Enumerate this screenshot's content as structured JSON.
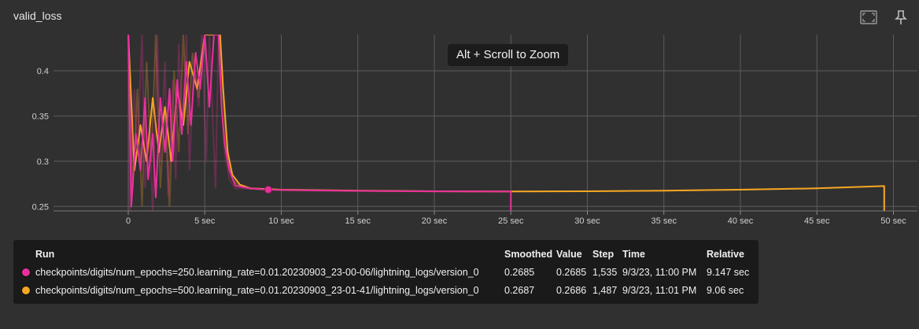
{
  "card": {
    "title": "valid_loss"
  },
  "toolbar": {
    "fit_icon": "fit-to-screen-icon",
    "pin_icon": "pin-icon"
  },
  "tooltip": {
    "text": "Alt + Scroll to Zoom"
  },
  "chart_data": {
    "type": "line",
    "title": "valid_loss",
    "xlabel": "",
    "ylabel": "",
    "xlim": [
      -4.5,
      52
    ],
    "ylim": [
      0.245,
      0.44
    ],
    "x_ticks": [
      "0",
      "5 sec",
      "10 sec",
      "15 sec",
      "20 sec",
      "25 sec",
      "30 sec",
      "35 sec",
      "40 sec",
      "45 sec",
      "50 sec"
    ],
    "x_tick_values": [
      0,
      5,
      10,
      15,
      20,
      25,
      30,
      35,
      40,
      45,
      50
    ],
    "y_ticks": [
      "0.25",
      "0.3",
      "0.35",
      "0.4"
    ],
    "y_tick_values": [
      0.25,
      0.3,
      0.35,
      0.4
    ],
    "grid": true,
    "highlight_point": {
      "x": 9.15,
      "y": 0.2685,
      "series": 0
    },
    "series": [
      {
        "name": "checkpoints/digits/num_epochs=250.learning_rate=0.01.20230903_23-00-06/lightning_logs/version_0",
        "color": "#e8309c",
        "raw": [
          [
            0,
            0.44
          ],
          [
            0.1,
            0.24
          ],
          [
            0.4,
            0.38
          ],
          [
            0.6,
            0.31
          ],
          [
            0.9,
            0.44
          ],
          [
            1.1,
            0.27
          ],
          [
            1.4,
            0.34
          ],
          [
            1.6,
            0.24
          ],
          [
            1.9,
            0.44
          ],
          [
            2.1,
            0.3
          ],
          [
            2.4,
            0.41
          ],
          [
            2.6,
            0.26
          ],
          [
            2.9,
            0.39
          ],
          [
            3.1,
            0.28
          ],
          [
            3.3,
            0.43
          ],
          [
            3.5,
            0.33
          ],
          [
            3.8,
            0.44
          ],
          [
            4,
            0.29
          ],
          [
            4.3,
            0.41
          ],
          [
            4.6,
            0.36
          ],
          [
            4.8,
            0.44
          ],
          [
            5.1,
            0.3
          ],
          [
            5.3,
            0.44
          ],
          [
            5.7,
            0.27
          ],
          [
            5.9,
            0.44
          ],
          [
            6.1,
            0.36
          ],
          [
            6.3,
            0.31
          ],
          [
            6.6,
            0.28
          ],
          [
            7,
            0.27
          ],
          [
            8,
            0.2695
          ],
          [
            9.15,
            0.2685
          ],
          [
            12,
            0.2675
          ],
          [
            15,
            0.267
          ],
          [
            20,
            0.2665
          ],
          [
            25,
            0.2663
          ],
          [
            25,
            0.24
          ]
        ],
        "smoothed": [
          [
            0,
            0.44
          ],
          [
            0.2,
            0.25
          ],
          [
            0.5,
            0.33
          ],
          [
            0.8,
            0.29
          ],
          [
            1.1,
            0.37
          ],
          [
            1.3,
            0.28
          ],
          [
            1.6,
            0.33
          ],
          [
            1.8,
            0.26
          ],
          [
            2.1,
            0.37
          ],
          [
            2.4,
            0.31
          ],
          [
            2.7,
            0.38
          ],
          [
            2.9,
            0.3
          ],
          [
            3.2,
            0.39
          ],
          [
            3.5,
            0.33
          ],
          [
            3.8,
            0.41
          ],
          [
            4.1,
            0.34
          ],
          [
            4.4,
            0.42
          ],
          [
            4.7,
            0.38
          ],
          [
            5,
            0.44
          ],
          [
            5.3,
            0.36
          ],
          [
            5.6,
            0.44
          ],
          [
            5.9,
            0.44
          ],
          [
            6.1,
            0.36
          ],
          [
            6.3,
            0.32
          ],
          [
            6.6,
            0.29
          ],
          [
            7,
            0.273
          ],
          [
            8,
            0.27
          ],
          [
            9.15,
            0.2685
          ],
          [
            12,
            0.2678
          ],
          [
            15,
            0.2672
          ],
          [
            20,
            0.2667
          ],
          [
            25,
            0.2665
          ],
          [
            25,
            0.24
          ]
        ]
      },
      {
        "name": "checkpoints/digits/num_epochs=500.learning_rate=0.01.20230903_23-01-41/lightning_logs/version_0",
        "color": "#f5a623",
        "raw": [
          [
            0,
            0.44
          ],
          [
            0.3,
            0.27
          ],
          [
            0.6,
            0.38
          ],
          [
            0.9,
            0.25
          ],
          [
            1.2,
            0.41
          ],
          [
            1.5,
            0.3
          ],
          [
            1.8,
            0.44
          ],
          [
            2.1,
            0.27
          ],
          [
            2.4,
            0.36
          ],
          [
            2.7,
            0.25
          ],
          [
            3,
            0.4
          ],
          [
            3.3,
            0.31
          ],
          [
            3.6,
            0.44
          ],
          [
            3.9,
            0.33
          ],
          [
            4.2,
            0.42
          ],
          [
            4.6,
            0.37
          ],
          [
            5,
            0.44
          ],
          [
            5.5,
            0.44
          ],
          [
            6,
            0.44
          ],
          [
            6.2,
            0.37
          ],
          [
            6.5,
            0.3
          ],
          [
            6.8,
            0.28
          ],
          [
            7.3,
            0.272
          ],
          [
            8,
            0.2695
          ],
          [
            10,
            0.268
          ],
          [
            15,
            0.2672
          ],
          [
            20,
            0.2667
          ],
          [
            25,
            0.2665
          ],
          [
            30,
            0.2668
          ],
          [
            35,
            0.2675
          ],
          [
            40,
            0.2685
          ],
          [
            45,
            0.27
          ],
          [
            49.4,
            0.2725
          ],
          [
            49.4,
            0.24
          ]
        ],
        "smoothed": [
          [
            0,
            0.44
          ],
          [
            0.4,
            0.29
          ],
          [
            0.8,
            0.34
          ],
          [
            1.2,
            0.3
          ],
          [
            1.6,
            0.37
          ],
          [
            2,
            0.31
          ],
          [
            2.4,
            0.36
          ],
          [
            2.8,
            0.3
          ],
          [
            3.2,
            0.38
          ],
          [
            3.6,
            0.34
          ],
          [
            4,
            0.41
          ],
          [
            4.5,
            0.38
          ],
          [
            5,
            0.44
          ],
          [
            5.5,
            0.44
          ],
          [
            6,
            0.44
          ],
          [
            6.2,
            0.38
          ],
          [
            6.5,
            0.31
          ],
          [
            6.8,
            0.285
          ],
          [
            7.3,
            0.274
          ],
          [
            8,
            0.27
          ],
          [
            10,
            0.2685
          ],
          [
            15,
            0.2675
          ],
          [
            20,
            0.2668
          ],
          [
            25,
            0.2665
          ],
          [
            30,
            0.2668
          ],
          [
            35,
            0.2675
          ],
          [
            40,
            0.2685
          ],
          [
            45,
            0.27
          ],
          [
            49.4,
            0.2725
          ],
          [
            49.4,
            0.24
          ]
        ]
      }
    ]
  },
  "legend": {
    "headers": {
      "run": "Run",
      "smoothed": "Smoothed",
      "value": "Value",
      "step": "Step",
      "time": "Time",
      "relative": "Relative"
    },
    "rows": [
      {
        "color": "#e8309c",
        "run": "checkpoints/digits/num_epochs=250.learning_rate=0.01.20230903_23-00-06/lightning_logs/version_0",
        "smoothed": "0.2685",
        "value": "0.2685",
        "step": "1,535",
        "time": "9/3/23, 11:00 PM",
        "relative": "9.147 sec"
      },
      {
        "color": "#f5a623",
        "run": "checkpoints/digits/num_epochs=500.learning_rate=0.01.20230903_23-01-41/lightning_logs/version_0",
        "smoothed": "0.2687",
        "value": "0.2686",
        "step": "1,487",
        "time": "9/3/23, 11:01 PM",
        "relative": "9.06 sec"
      }
    ]
  }
}
